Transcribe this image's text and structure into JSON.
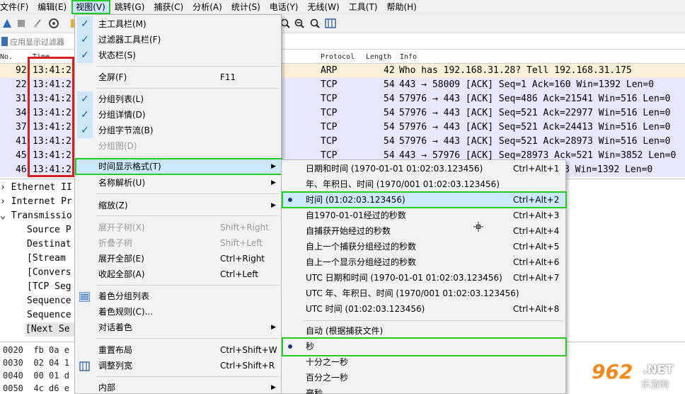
{
  "menubar": {
    "items": [
      "文件(F)",
      "编辑(E)",
      "视图(V)",
      "跳转(G)",
      "捕获(C)",
      "分析(A)",
      "统计(S)",
      "电话(Y)",
      "无线(W)",
      "工具(T)",
      "帮助(H)"
    ]
  },
  "filter": {
    "placeholder": "应用显示过滤器"
  },
  "packet_list": {
    "headers": {
      "no": "No.",
      "time": "Time",
      "protocol": "Protocol",
      "length": "Length",
      "info": "Info"
    },
    "rows": [
      {
        "no": "92",
        "time": "13:41:2",
        "protocol": "ARP",
        "length": "42",
        "info": "Who has 192.168.31.28? Tell 192.168.31.175"
      },
      {
        "no": "22",
        "time": "13:41:2",
        "protocol": "TCP",
        "length": "54",
        "info": "443 → 58009 [ACK] Seq=1 Ack=160 Win=1392 Len=0"
      },
      {
        "no": "31",
        "time": "13:41:2",
        "protocol": "TCP",
        "length": "54",
        "info": "57976 → 443 [ACK] Seq=486 Ack=21541 Win=516 Len=0"
      },
      {
        "no": "34",
        "time": "13:41:2",
        "protocol": "TCP",
        "length": "54",
        "info": "57976 → 443 [ACK] Seq=521 Ack=22977 Win=516 Len=0"
      },
      {
        "no": "37",
        "time": "13:41:2",
        "protocol": "TCP",
        "length": "54",
        "info": "57976 → 443 [ACK] Seq=521 Ack=24413 Win=516 Len=0"
      },
      {
        "no": "41",
        "time": "13:41:2",
        "protocol": "TCP",
        "length": "54",
        "info": "57976 → 443 [ACK] Seq=521 Ack=28973 Win=516 Len=0"
      },
      {
        "no": "45",
        "time": "13:41:2",
        "protocol": "TCP",
        "length": "54",
        "info": "443 → 57976 [ACK] Seq=28973 Ack=521 Win=3852 Len=0"
      },
      {
        "no": "46",
        "time": "13:41:2",
        "protocol": "TCP",
        "length": "",
        "info": "8 Win=1392 Len=0"
      }
    ]
  },
  "details": {
    "rows": [
      "Ethernet II",
      "Internet Pr",
      "Transmissio",
      "Source P",
      "Destinat",
      "[Stream",
      "[Convers",
      "[TCP Seg",
      "Sequence",
      "Sequence",
      "[Next Se"
    ]
  },
  "bytes": {
    "rows": [
      {
        "offset": "0020",
        "hex": "fb 0a e"
      },
      {
        "offset": "0030",
        "hex": "02 04 1"
      },
      {
        "offset": "0040",
        "hex": "00 01 d"
      },
      {
        "offset": "0050",
        "hex": "4c d6 e"
      }
    ]
  },
  "view_menu": {
    "main_toolbar": "主工具栏(M)",
    "filter_toolbar": "过滤器工具栏(F)",
    "status_bar": "状态栏(S)",
    "fullscreen": "全屏(F)",
    "fullscreen_sc": "F11",
    "packet_list": "分组列表(L)",
    "packet_details": "分组详情(D)",
    "packet_bytes": "分组字节流(B)",
    "packet_diagram": "分组图(D)",
    "time_format": "时间显示格式(T)",
    "name_resolution": "名称解析(U)",
    "zoom": "缩放(Z)",
    "expand_subtrees": "展开子树(X)",
    "expand_subtrees_sc": "Shift+Right",
    "collapse_subtrees": "折叠子树",
    "collapse_subtrees_sc": "Shift+Left",
    "expand_all": "展开全部(E)",
    "expand_all_sc": "Ctrl+Right",
    "collapse_all": "收起全部(A)",
    "collapse_all_sc": "Ctrl+Left",
    "colorize_list": "着色分组列表",
    "coloring_rules": "着色规则(C)...",
    "colorize_conversation": "对话着色",
    "reset_layout": "重置布局",
    "reset_layout_sc": "Ctrl+Shift+W",
    "resize_columns": "调整列宽",
    "resize_columns_sc": "Ctrl+Shift+R",
    "internals": "内部"
  },
  "time_menu": {
    "items": [
      {
        "label": "日期和时间 (1970-01-01 01:02:03.123456)",
        "shortcut": "Ctrl+Alt+1"
      },
      {
        "label": "年、年积日、时间 (1970/001 01:02:03.123456)",
        "shortcut": ""
      },
      {
        "label": "时间 (01:02:03.123456)",
        "shortcut": "Ctrl+Alt+2"
      },
      {
        "label": "自1970-01-01经过的秒数",
        "shortcut": "Ctrl+Alt+3"
      },
      {
        "label": "自捕获开始经过的秒数",
        "shortcut": "Ctrl+Alt+4"
      },
      {
        "label": "自上一个捕获分组经过的秒数",
        "shortcut": "Ctrl+Alt+5"
      },
      {
        "label": "自上一个显示分组经过的秒数",
        "shortcut": "Ctrl+Alt+6"
      },
      {
        "label": "UTC 日期和时间 (1970-01-01 01:02:03.123456)",
        "shortcut": "Ctrl+Alt+7"
      },
      {
        "label": "UTC 年、年积日、时间 (1970/001 01:02:03.123456)",
        "shortcut": ""
      },
      {
        "label": "UTC 时间 (01:02:03.123456)",
        "shortcut": "Ctrl+Alt+8"
      }
    ],
    "precision": [
      "自动 (根据捕获文件)",
      "秒",
      "十分之一秒",
      "百分之一秒",
      "毫秒"
    ]
  },
  "watermark": {
    "logo": "962",
    "net": ".NET",
    "site": "乐游网"
  }
}
